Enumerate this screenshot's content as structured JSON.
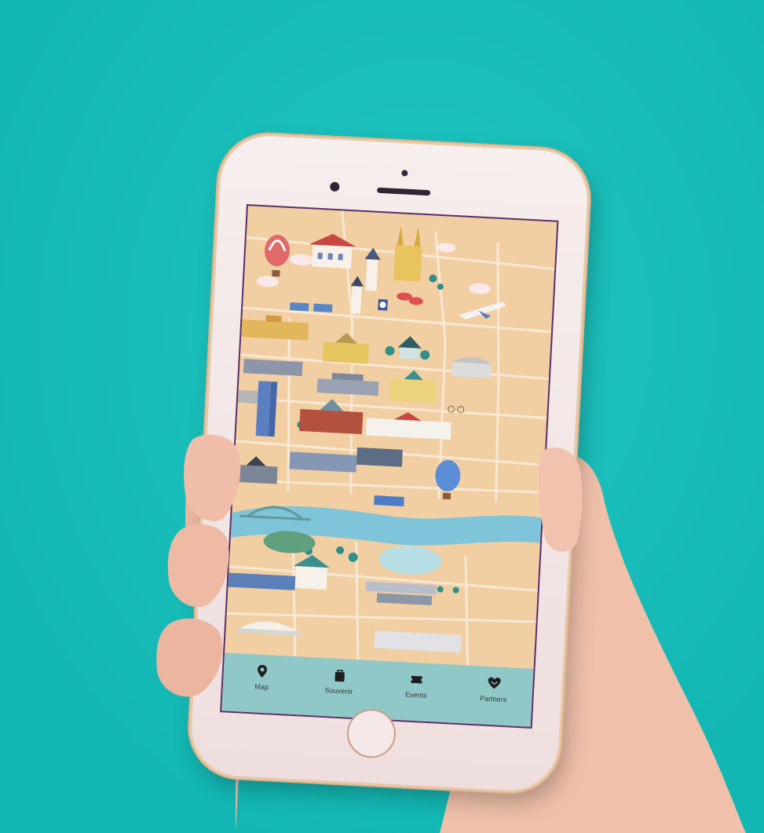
{
  "colors": {
    "background": "#13c1bd",
    "map_land": "#f1cfa3",
    "river": "#7fc4d8",
    "tabbar": "#8fc8c7",
    "screen_border": "#5b2f6a"
  },
  "tabbar": {
    "items": [
      {
        "label": "Map",
        "icon": "map-pin-icon"
      },
      {
        "label": "Souvenir",
        "icon": "shopping-bag-icon"
      },
      {
        "label": "Events",
        "icon": "ticket-icon"
      },
      {
        "label": "Partners",
        "icon": "handshake-heart-icon"
      }
    ]
  }
}
